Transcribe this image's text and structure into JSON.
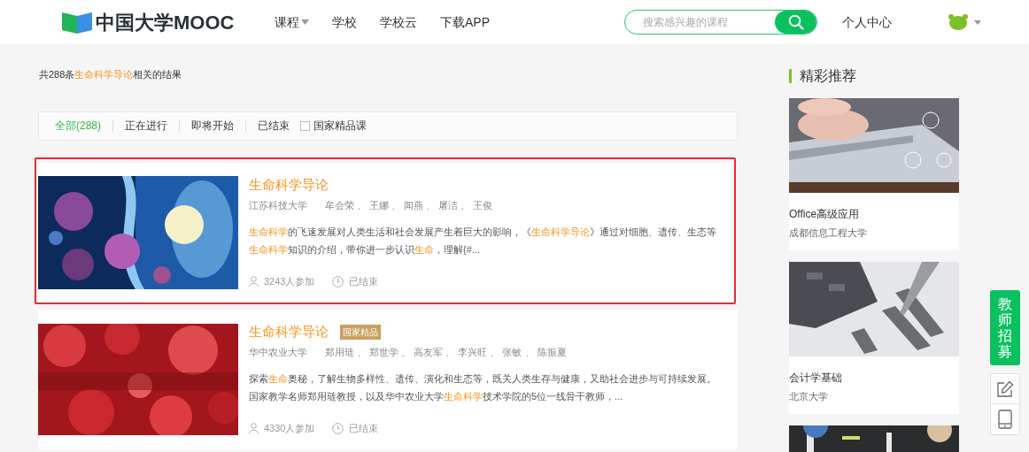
{
  "header": {
    "logo": "中国大学MOOC",
    "nav": [
      {
        "label": "课程",
        "dropdown": true
      },
      {
        "label": "学校",
        "dropdown": false
      },
      {
        "label": "学校云",
        "dropdown": false
      },
      {
        "label": "下载APP",
        "dropdown": false
      }
    ],
    "search": {
      "placeholder": "搜索感兴趣的课程"
    },
    "user_center": "个人中心"
  },
  "result_summary": [
    {
      "text": "共288条",
      "highlight": false
    },
    {
      "text": "生命科学导论",
      "highlight": true
    },
    {
      "text": "相关的结果",
      "highlight": false
    }
  ],
  "filters": {
    "tabs": [
      {
        "label": "全部(288)",
        "selected": true
      },
      {
        "label": "正在进行",
        "selected": false
      },
      {
        "label": "即将开始",
        "selected": false
      },
      {
        "label": "已结束",
        "selected": false
      }
    ],
    "checkbox": {
      "label": "国家精品课",
      "checked": false
    }
  },
  "courses": [
    {
      "title": "生命科学导论",
      "school": "江苏科技大学",
      "teachers": "牟会荣 、 王娜 、 闻燕 、 屠洁 、 王俊",
      "highlighted": true,
      "description": [
        {
          "text": "生命科学",
          "highlight": true
        },
        {
          "text": "的飞速发展对人类生活和社会发展产生着巨大的影响，《",
          "highlight": false
        },
        {
          "text": "生命科学导论",
          "highlight": true
        },
        {
          "text": "》通过对细胞、遗传、生态等",
          "highlight": false
        },
        {
          "text": "生命科学",
          "highlight": true
        },
        {
          "text": "知识的介绍，带你进一步认识",
          "highlight": false
        },
        {
          "text": "生命",
          "highlight": true
        },
        {
          "text": "，理解{#...",
          "highlight": false
        }
      ],
      "enrolled": "3243人参加",
      "status": "已结束"
    },
    {
      "title": "生命科学导论",
      "badge": "国家精品",
      "school": "华中农业大学",
      "teachers": "郑用琏 、 郑世学 、 高友军 、 李兴旺 、 张敏 、 陈振夏",
      "highlighted": false,
      "description": [
        {
          "text": "探索",
          "highlight": false
        },
        {
          "text": "生命",
          "highlight": true
        },
        {
          "text": "奥秘，了解生物多样性、遗传、演化和生态等，既关人类生存与健康，又助社会进步与可持续发展。国家教学名师郑用琏教授，以及华中农业大学",
          "highlight": false
        },
        {
          "text": "生命科学",
          "highlight": true
        },
        {
          "text": "技术学院的5位一线骨干教师，...",
          "highlight": false
        }
      ],
      "enrolled": "4330人参加",
      "status": "已结束"
    }
  ],
  "sidebar": {
    "title": "精彩推荐",
    "items": [
      {
        "name": "Office高级应用",
        "school": "成都信息工程大学"
      },
      {
        "name": "会计学基础",
        "school": "北京大学"
      }
    ]
  },
  "float_button": "教师招募"
}
